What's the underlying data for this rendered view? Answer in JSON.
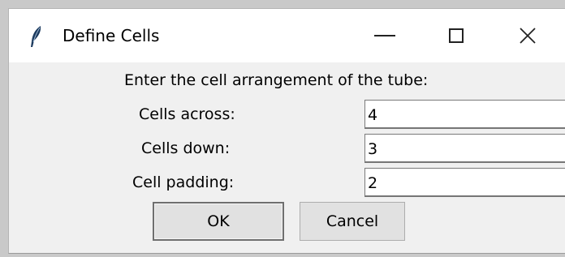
{
  "window": {
    "title": "Define Cells",
    "icon": "feather-icon",
    "controls": [
      "minimize-icon",
      "maximize-icon",
      "close-icon"
    ]
  },
  "dialog": {
    "prompt": "Enter the cell arrangement of the tube:",
    "fields": [
      {
        "label": "Cells across:",
        "value": "4"
      },
      {
        "label": "Cells down:",
        "value": "3"
      },
      {
        "label": "Cell padding:",
        "value": "2"
      }
    ],
    "buttons": {
      "ok": "OK",
      "cancel": "Cancel"
    }
  }
}
